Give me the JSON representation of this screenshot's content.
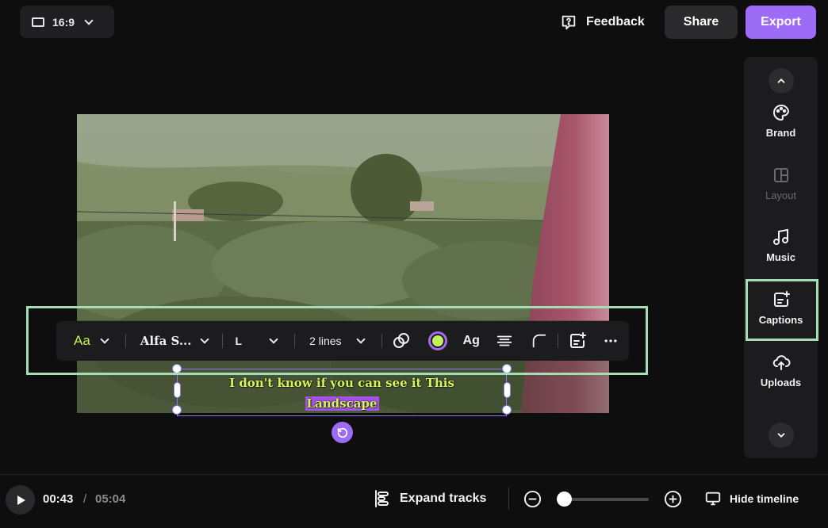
{
  "topbar": {
    "aspect_ratio": "16:9",
    "feedback_label": "Feedback",
    "share_label": "Share",
    "export_label": "Export"
  },
  "caption_toolbar": {
    "style_label": "Aa",
    "font_label": "Alfa S...",
    "size_label": "L",
    "lines_label": "2 lines",
    "text_effect_label": "Ag",
    "highlight_color": "#c7ef5a"
  },
  "subtitle": {
    "line1": "I don't know if you can see it This",
    "line2": "Landscape"
  },
  "sidebar": {
    "items": [
      {
        "label": "Brand",
        "icon": "palette-icon"
      },
      {
        "label": "Layout",
        "icon": "layout-icon"
      },
      {
        "label": "Music",
        "icon": "music-note-icon"
      },
      {
        "label": "Captions",
        "icon": "captions-icon"
      },
      {
        "label": "Uploads",
        "icon": "upload-cloud-icon"
      }
    ]
  },
  "playback": {
    "current_time": "00:43",
    "separator": "/",
    "total_time": "05:04",
    "zoom_level": 0.05
  },
  "timeline_controls": {
    "expand_label": "Expand tracks",
    "hide_label": "Hide timeline"
  },
  "colors": {
    "accent": "#9d6cf6",
    "highlight_outline": "#a6dcb6",
    "subtitle_text": "#d6f35a"
  }
}
